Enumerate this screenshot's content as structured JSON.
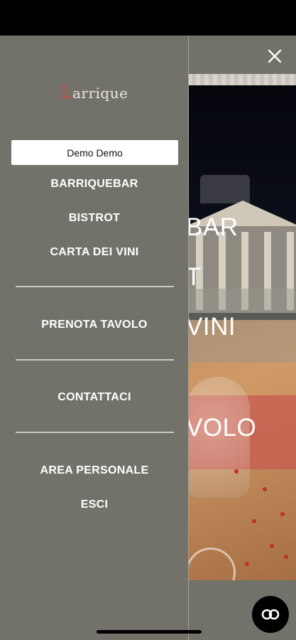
{
  "drawer": {
    "logo_text": "Barrique",
    "logo_prefix": "L",
    "logo_rest": "arrique",
    "user_name": "Demo Demo",
    "menu": {
      "barriquebar": "BARRIQUEBAR",
      "bistrot": "BISTROT",
      "carta_dei_vini": "CARTA DEI VINI",
      "prenota_tavolo": "PRENOTA TAVOLO",
      "contattaci": "CONTATTACI",
      "area_personale": "AREA PERSONALE",
      "esci": "ESCI"
    }
  },
  "background": {
    "hero_words": [
      "BAR",
      "T",
      "VINI",
      "VOLO"
    ]
  },
  "icons": {
    "close": "close-icon",
    "chat": "chat-icon"
  },
  "colors": {
    "drawer_bg": "#72726a",
    "accent": "#c44b43",
    "text": "#ffffff"
  }
}
